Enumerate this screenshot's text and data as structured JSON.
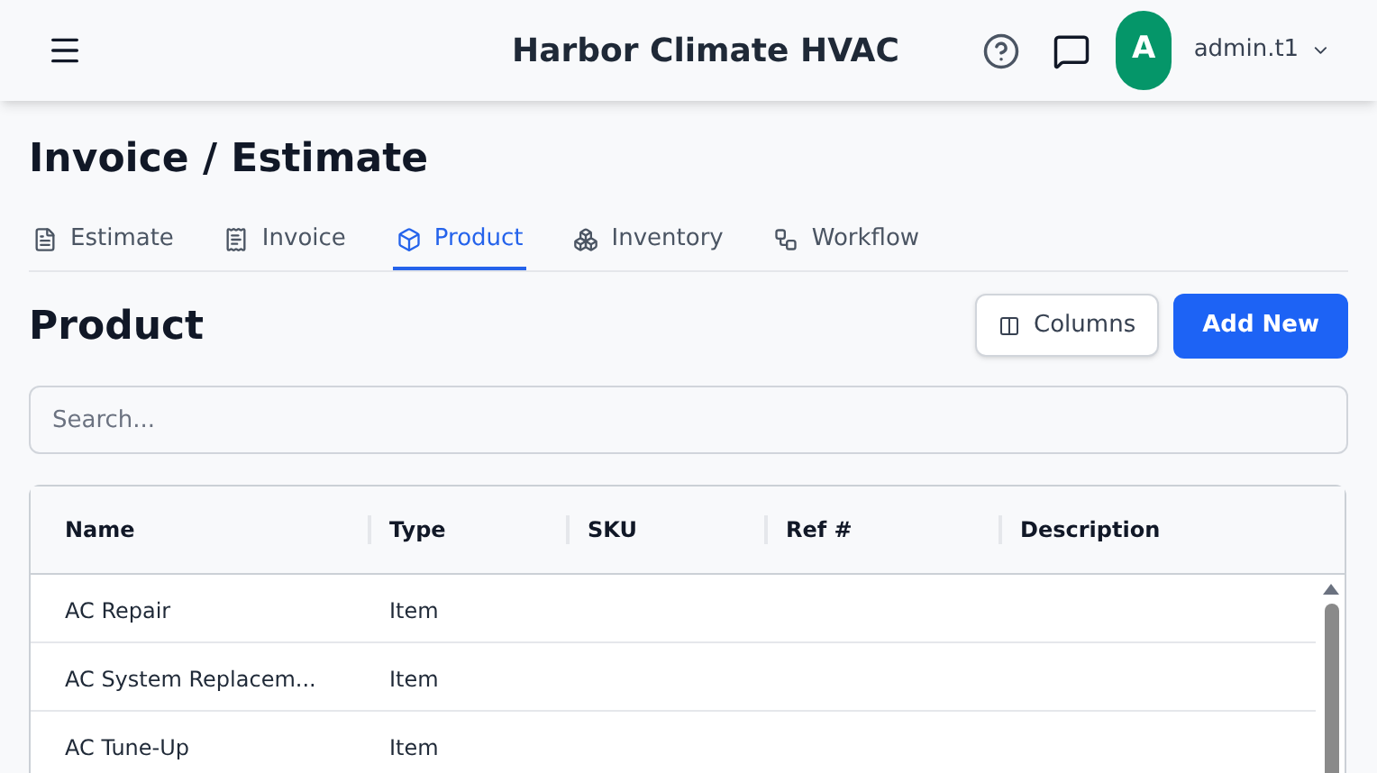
{
  "header": {
    "title": "Harbor Climate HVAC",
    "avatar_initial": "A",
    "username": "admin.t1"
  },
  "page_title": "Invoice / Estimate",
  "tabs": [
    {
      "label": "Estimate",
      "selected": false
    },
    {
      "label": "Invoice",
      "selected": false
    },
    {
      "label": "Product",
      "selected": true
    },
    {
      "label": "Inventory",
      "selected": false
    },
    {
      "label": "Workflow",
      "selected": false
    }
  ],
  "section_title": "Product",
  "buttons": {
    "columns": "Columns",
    "add_new": "Add New"
  },
  "search": {
    "placeholder": "Search..."
  },
  "table": {
    "columns": [
      "Name",
      "Type",
      "SKU",
      "Ref #",
      "Description"
    ],
    "rows": [
      [
        "AC Repair",
        "Item",
        "",
        "",
        ""
      ],
      [
        "AC System Replacem...",
        "Item",
        "",
        "",
        ""
      ],
      [
        "AC Tune-Up",
        "Item",
        "",
        "",
        ""
      ]
    ]
  }
}
